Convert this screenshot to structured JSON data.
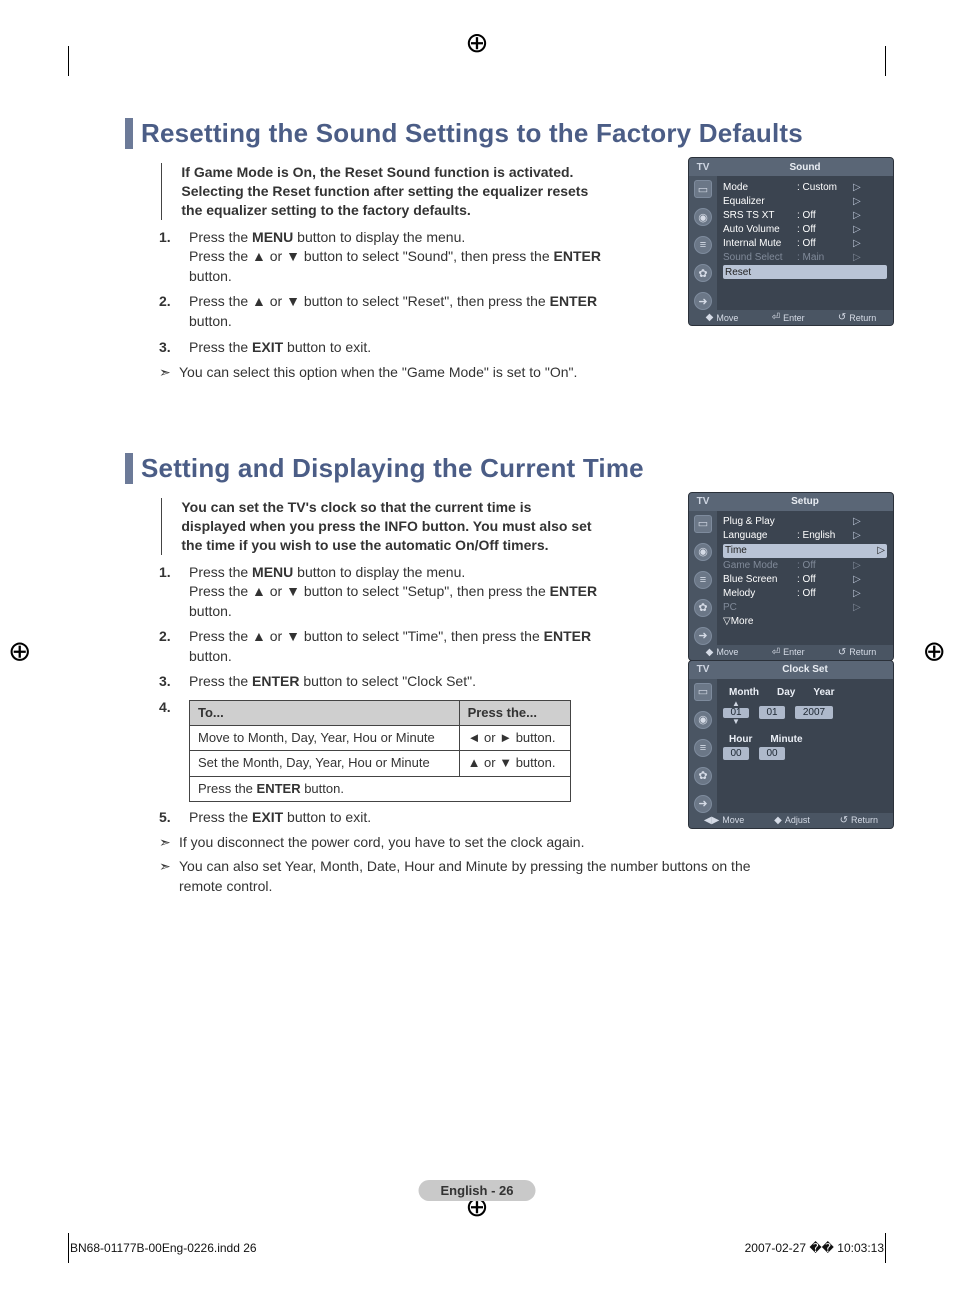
{
  "registration_glyph": "⊕",
  "section1": {
    "title": "Resetting the Sound Settings to the Factory Defaults",
    "intro": "If Game Mode is On, the Reset Sound function is activated. Selecting the Reset function after setting the equalizer resets the equalizer setting to the factory defaults.",
    "steps": [
      {
        "num": "1.",
        "text_pre": "Press the ",
        "bold1": "MENU",
        "text_mid": " button to display the menu.\nPress the ▲ or ▼  button to select \"Sound\", then press the ",
        "bold2": "ENTER",
        "text_post": " button."
      },
      {
        "num": "2.",
        "text_pre": "Press the ▲ or ▼ button to select \"Reset\", then press the ",
        "bold1": "ENTER",
        "text_mid": " button.",
        "bold2": "",
        "text_post": ""
      },
      {
        "num": "3.",
        "text_pre": "Press the ",
        "bold1": "EXIT",
        "text_mid": " button to exit.",
        "bold2": "",
        "text_post": ""
      }
    ],
    "note_mark": "➣",
    "note": "You can select this option when the \"Game Mode\" is set to \"On\"."
  },
  "section2": {
    "title": "Setting and Displaying the Current Time",
    "intro": "You can set the TV's clock so that the current time is displayed when you press the INFO button. You must also set the time if you wish to use the automatic On/Off timers.",
    "steps": [
      {
        "num": "1.",
        "text_pre": "Press the ",
        "bold1": "MENU",
        "text_mid": " button to display the menu.\nPress the ▲ or ▼ button to select \"Setup\", then press the ",
        "bold2": "ENTER",
        "text_post": " button."
      },
      {
        "num": "2.",
        "text_pre": "Press the ▲ or ▼ button to select \"Time\", then press the ",
        "bold1": "ENTER",
        "text_mid": " button.",
        "bold2": "",
        "text_post": ""
      },
      {
        "num": "3.",
        "text_pre": "Press the ",
        "bold1": "ENTER",
        "text_mid": " button to select \"Clock Set\".",
        "bold2": "",
        "text_post": ""
      },
      {
        "num": "4.",
        "text_pre": "",
        "bold1": "",
        "text_mid": "",
        "bold2": "",
        "text_post": ""
      },
      {
        "num": "5.",
        "text_pre": "Press the ",
        "bold1": "EXIT",
        "text_mid": " button to exit.",
        "bold2": "",
        "text_post": ""
      }
    ],
    "table": {
      "head": [
        "To...",
        "Press the..."
      ],
      "rows": [
        [
          "Move to Month, Day, Year, Hou or Minute",
          "◄ or ► button."
        ],
        [
          "Set the Month, Day, Year, Hou or Minute",
          "▲ or ▼ button."
        ]
      ],
      "footrow_pre": "Press the ",
      "footrow_bold": "ENTER",
      "footrow_post": " button."
    },
    "notes": [
      "If you disconnect the power cord, you have to set the clock again.",
      "You can also set Year, Month, Date, Hour and Minute by pressing the number buttons on the remote control."
    ],
    "note_mark": "➣"
  },
  "osd_sound": {
    "tv": "TV",
    "title": "Sound",
    "rows": [
      {
        "label": "Mode",
        "value": ": Custom"
      },
      {
        "label": "Equalizer",
        "value": ""
      },
      {
        "label": "SRS TS XT",
        "value": ": Off"
      },
      {
        "label": "Auto Volume",
        "value": ": Off"
      },
      {
        "label": "Internal Mute",
        "value": ": Off"
      },
      {
        "label": "Sound Select",
        "value": ": Main",
        "dim": true
      }
    ],
    "selected": "Reset",
    "foot": {
      "move": "Move",
      "enter": "Enter",
      "return": "Return"
    }
  },
  "osd_setup": {
    "tv": "TV",
    "title": "Setup",
    "rows": [
      {
        "label": "Plug & Play",
        "value": ""
      },
      {
        "label": "Language",
        "value": ": English"
      }
    ],
    "selected": "Time",
    "rowsAfter": [
      {
        "label": "Game Mode",
        "value": ": Off",
        "dim": true
      },
      {
        "label": "Blue Screen",
        "value": ": Off"
      },
      {
        "label": "Melody",
        "value": ": Off"
      },
      {
        "label": "PC",
        "value": "",
        "dim": true
      }
    ],
    "more": "▽More",
    "foot": {
      "move": "Move",
      "enter": "Enter",
      "return": "Return"
    }
  },
  "osd_clock": {
    "tv": "TV",
    "title": "Clock Set",
    "labels1": [
      "Month",
      "Day",
      "Year"
    ],
    "values1": [
      "01",
      "01",
      "2007"
    ],
    "labels2": [
      "Hour",
      "Minute"
    ],
    "values2": [
      "00",
      "00"
    ],
    "foot": {
      "move": "Move",
      "adjust": "Adjust",
      "return": "Return"
    }
  },
  "page_label": "English - 26",
  "print_left": "BN68-01177B-00Eng-0226.indd   26",
  "print_right": "2007-02-27   �� 10:03:13",
  "glyphs": {
    "right_tri": "▷",
    "updown": "◆",
    "enter": "⏎",
    "return": "↺",
    "lrarrow": "◀▶",
    "adjust": "◆"
  }
}
